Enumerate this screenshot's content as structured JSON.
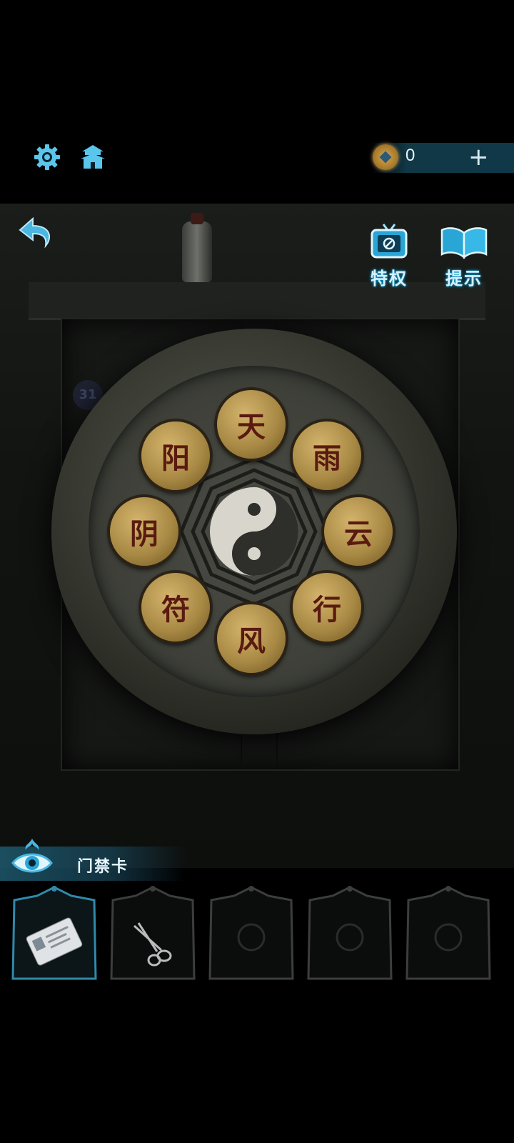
{
  "topbar": {
    "coins": "0",
    "plus": "+"
  },
  "side_buttons": [
    {
      "label": "特权",
      "icon": "tv-icon"
    },
    {
      "label": "提示",
      "icon": "book-icon"
    }
  ],
  "scene": {
    "wall_number": "31"
  },
  "puzzle": {
    "buttons": [
      {
        "glyph": "天"
      },
      {
        "glyph": "雨"
      },
      {
        "glyph": "云"
      },
      {
        "glyph": "行"
      },
      {
        "glyph": "风"
      },
      {
        "glyph": "符"
      },
      {
        "glyph": "阴"
      },
      {
        "glyph": "阳"
      }
    ]
  },
  "inventory": {
    "selected_item_name": "门禁卡",
    "slots": [
      {
        "item": "access-card",
        "selected": true
      },
      {
        "item": "scissors",
        "selected": false
      },
      {
        "item": "empty",
        "selected": false
      },
      {
        "item": "empty",
        "selected": false
      },
      {
        "item": "empty",
        "selected": false
      }
    ]
  }
}
